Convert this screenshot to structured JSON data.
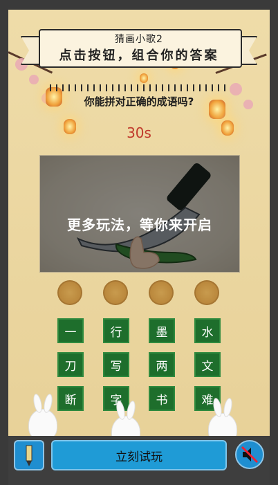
{
  "banner": {
    "title": "猜画小歌2",
    "subtitle": "点击按钮，组合你的答案"
  },
  "question": "你能拼对正确的成语吗?",
  "timer": "30s",
  "picture": {
    "overlay_text": "更多玩法，等你来开启",
    "depicts": "knife and cucumber with tapping hand"
  },
  "answer_slots": 4,
  "keys": [
    [
      "一",
      "行",
      "墨",
      "水"
    ],
    [
      "刀",
      "写",
      "两",
      "文"
    ],
    [
      "断",
      "字",
      "书",
      "难"
    ]
  ],
  "bottom": {
    "play_label": "立刻试玩",
    "app_icon": "pencil-icon",
    "sound_icon": "speaker-muted-icon"
  },
  "colors": {
    "key_bg": "#1e6e2c",
    "play_bg": "#1f9bd6",
    "timer": "#c0392b",
    "slot": "#b27c31"
  }
}
